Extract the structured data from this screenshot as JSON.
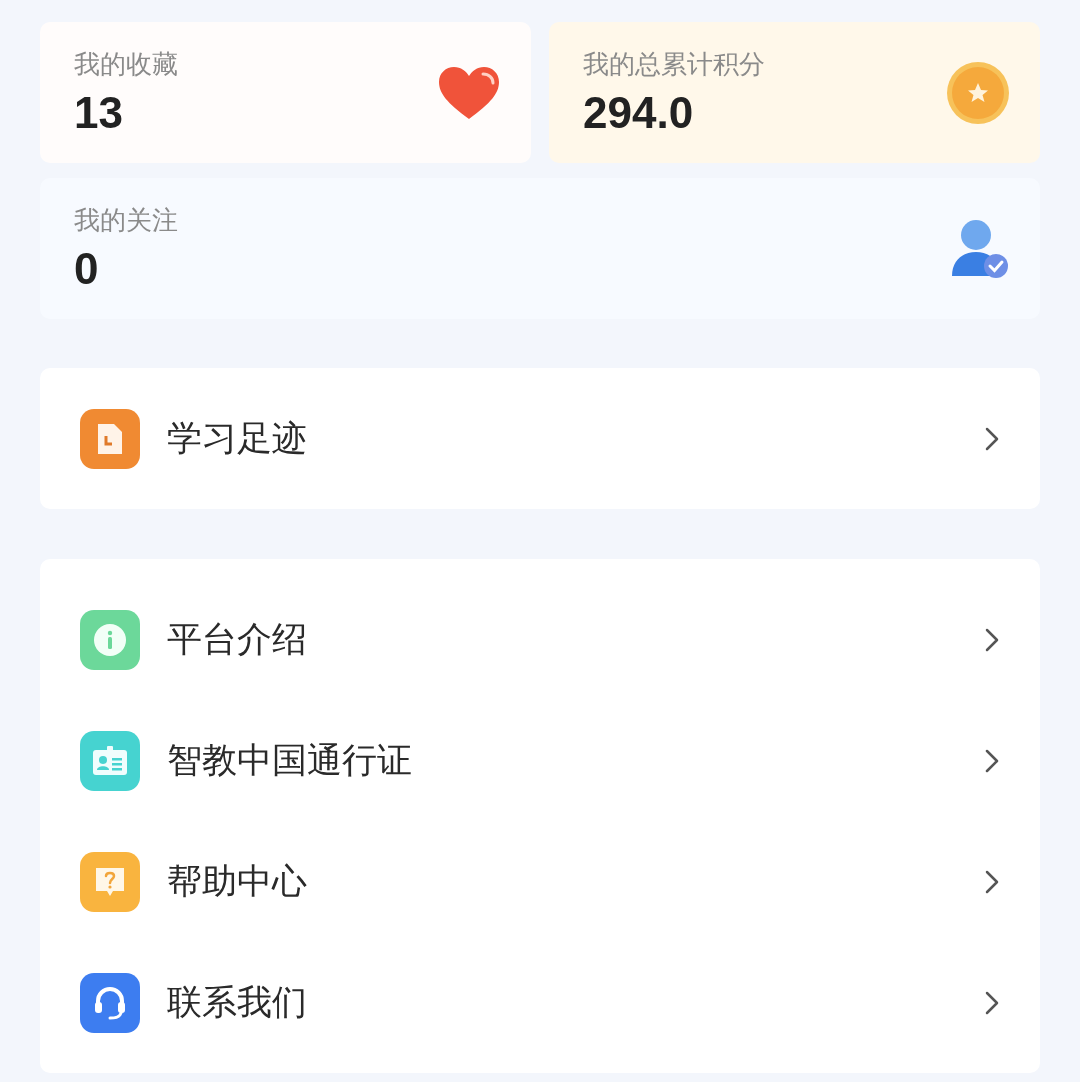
{
  "stats": [
    {
      "kind": "favorites",
      "label": "我的收藏",
      "value": "13"
    },
    {
      "kind": "points",
      "label": "我的总累计积分",
      "value": "294.0"
    },
    {
      "kind": "follows",
      "label": "我的关注",
      "value": "0"
    }
  ],
  "menu_groups": [
    [
      {
        "kind": "history",
        "label": "学习足迹"
      }
    ],
    [
      {
        "kind": "info",
        "label": "平台介绍"
      },
      {
        "kind": "pass",
        "label": "智教中国通行证"
      },
      {
        "kind": "help",
        "label": "帮助中心"
      },
      {
        "kind": "contact",
        "label": "联系我们"
      }
    ]
  ]
}
